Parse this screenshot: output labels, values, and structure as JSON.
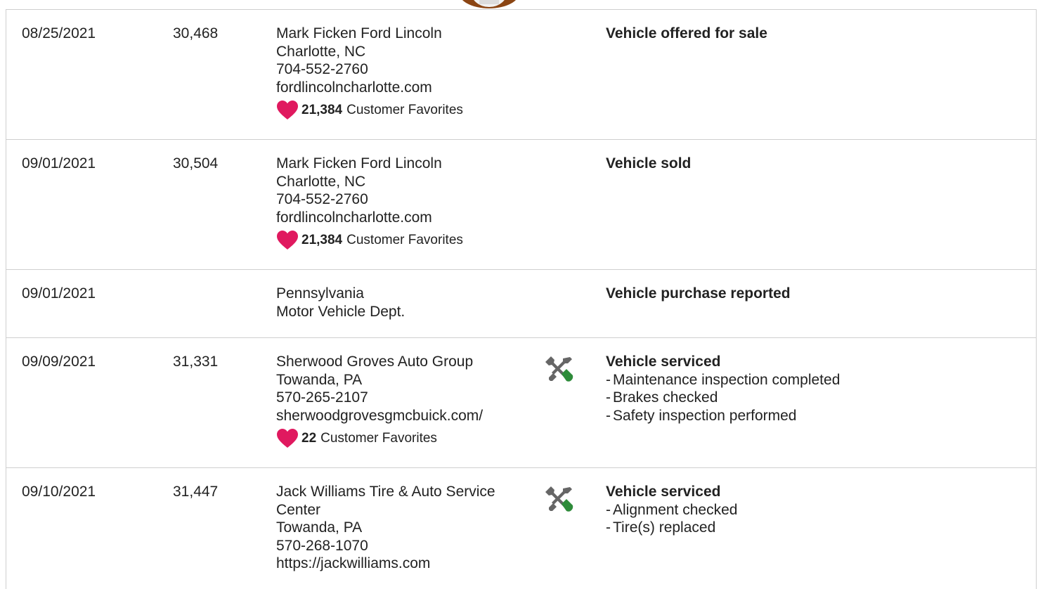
{
  "rows": [
    {
      "date": "08/25/2021",
      "odometer": "30,468",
      "source": [
        "Mark Ficken Ford Lincoln",
        "Charlotte, NC",
        "704-552-2760",
        "fordlincolncharlotte.com"
      ],
      "favorites_count": "21,384",
      "favorites_label": "Customer Favorites",
      "detail_title": "Vehicle offered for sale",
      "details": []
    },
    {
      "date": "09/01/2021",
      "odometer": "30,504",
      "source": [
        "Mark Ficken Ford Lincoln",
        "Charlotte, NC",
        "704-552-2760",
        "fordlincolncharlotte.com"
      ],
      "favorites_count": "21,384",
      "favorites_label": "Customer Favorites",
      "detail_title": "Vehicle sold",
      "details": []
    },
    {
      "date": "09/01/2021",
      "odometer": "",
      "source": [
        "Pennsylvania",
        "Motor Vehicle Dept."
      ],
      "detail_title": "Vehicle purchase reported",
      "details": []
    },
    {
      "date": "09/09/2021",
      "odometer": "31,331",
      "source": [
        "Sherwood Groves Auto Group",
        "Towanda, PA",
        "570-265-2107",
        "sherwoodgrovesgmcbuick.com/"
      ],
      "favorites_count": "22",
      "favorites_label": "Customer Favorites",
      "icon": "service-tools-icon",
      "detail_title": "Vehicle serviced",
      "details": [
        "Maintenance inspection completed",
        "Brakes checked",
        "Safety inspection performed"
      ]
    },
    {
      "date": "09/10/2021",
      "odometer": "31,447",
      "source": [
        "Jack Williams Tire & Auto Service Center",
        "Towanda, PA",
        "570-268-1070",
        "https://jackwilliams.com"
      ],
      "icon": "service-tools-icon",
      "detail_title": "Vehicle serviced",
      "details": [
        "Alignment checked",
        "Tire(s) replaced"
      ]
    }
  ],
  "colors": {
    "heart": "#e0195f",
    "wrench_head": "#666666",
    "screwdriver_handle": "#2e8b3a",
    "border": "#cfcfcf",
    "text": "#222222"
  }
}
